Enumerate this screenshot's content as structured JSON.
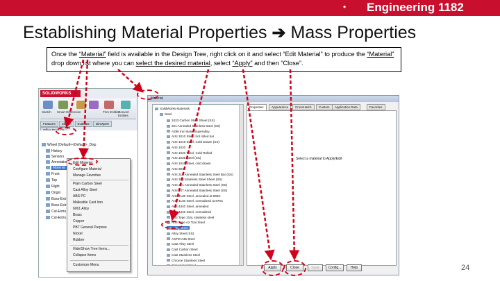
{
  "header": {
    "bullet": "•",
    "course": "Engineering 1182"
  },
  "slide": {
    "title_left": "Establishing Material Properties ",
    "title_arrow": "➔",
    "title_right": " Mass Properties",
    "page_number": "24",
    "instructions": {
      "t1": "Once the ",
      "u1": "“Material”",
      "t2": " field is available in the Design Tree, right click on it and select “Edit Material” to produce the ",
      "u2": "“Material”",
      "t3": " drop down list where you can ",
      "u3": "select the desired material",
      "t4": ", select ",
      "u4": "“Apply”",
      "t5": " and then “Close”."
    }
  },
  "solidworks": {
    "logo": "SOLIDWORKS",
    "tools": [
      "Sketch",
      "Smart Dimension",
      "",
      "",
      "Trim Entities",
      "Convert Entities"
    ],
    "tabs": [
      "Features",
      "Sketch",
      "Evaluate",
      "DimXpert",
      "Office Products"
    ],
    "tree": [
      "Wheel (Default<<Default>_Disp",
      "History",
      "Sensors",
      "Annotations",
      "Material",
      "Front",
      "Top",
      "Right",
      "Origin",
      "Boss-Extr",
      "Boss-Extr",
      "Cut-Extru",
      "Cut-Extru"
    ],
    "context_menu": [
      "Edit Material",
      "Configure Material",
      "Manage Favorites",
      "Plain Carbon Steel",
      "Cast Alloy Steel",
      "ABS PC",
      "Malleable Cast Iron",
      "6061 Alloy",
      "Brass",
      "Copper",
      "PBT General Purpose",
      "Nickel",
      "Rubber",
      "Hide/Show Tree Items...",
      "Collapse Items",
      "Customize Menu"
    ]
  },
  "dialog": {
    "caption": "Material",
    "root": "SolidWorks Materials",
    "steel_folder": "Steel",
    "materials": [
      "1023 Carbon Steel Sheet (SS)",
      "201 Annealed Stainless Steel (SS)",
      "A286 Iron Base Superalloy",
      "AISI 1010 Steel, hot rolled bar",
      "AISI 1015 Steel, Cold Drawn (SS)",
      "AISI 1020",
      "AISI 1020 Steel, Cold Rolled",
      "AISI 1035 Steel (SS)",
      "AISI 1045 Steel, cold drawn",
      "AISI 304",
      "AISI 316 Annealed Stainless Steel Bar (SS)",
      "AISI 316 Stainless Steel Sheet (SS)",
      "AISI 321 Annealed Stainless Steel (SS)",
      "AISI 347 Annealed Stainless Steel (SS)",
      "AISI 4130 Steel, annealed at 865C",
      "AISI 4130 Steel, normalized at 870C",
      "AISI 4340 Steel, annealed",
      "AISI 4340 Steel, normalized",
      "AISI Type 316L stainless steel",
      "AISI Type A2 Tool Steel",
      "Alloy Steel",
      "Alloy Steel (SS)",
      "ASTM A36 Steel",
      "Cast Alloy Steel",
      "Cast Carbon Steel",
      "Cast Stainless Steel",
      "Chrome Stainless Steel",
      "Galvanized Steel"
    ],
    "tabs": [
      "Properties",
      "Appearance",
      "CrossHatch",
      "Custom",
      "Application Data",
      "Favorites"
    ],
    "note": "Select a material to Apply/Edit",
    "buttons": {
      "apply": "Apply",
      "close": "Close",
      "save": "Save",
      "config": "Config...",
      "help": "Help"
    }
  },
  "colors": {
    "accent": "#c8102e",
    "annotation": "#d0021b",
    "selection": "#3a72c4"
  }
}
